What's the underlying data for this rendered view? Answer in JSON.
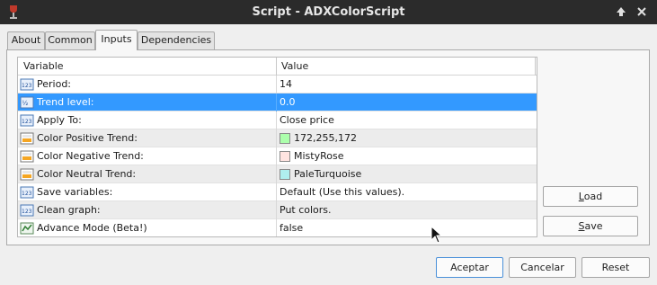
{
  "window": {
    "title": "Script - ADXColorScript"
  },
  "tabs": [
    {
      "label": "About"
    },
    {
      "label": "Common"
    },
    {
      "label": "Inputs"
    },
    {
      "label": "Dependencies"
    }
  ],
  "table": {
    "headers": {
      "variable": "Variable",
      "value": "Value"
    },
    "rows": [
      {
        "icon": "123-int-icon",
        "name": "Period:",
        "value": "14"
      },
      {
        "icon": "decimal-icon",
        "name": "Trend level:",
        "value": "0.0",
        "selected": true
      },
      {
        "icon": "123-int-icon",
        "name": "Apply To:",
        "value": "Close price"
      },
      {
        "icon": "color-icon",
        "name": "Color Positive Trend:",
        "value": "172,255,172",
        "swatch": "#acffac"
      },
      {
        "icon": "color-icon",
        "name": "Color Negative Trend:",
        "value": "MistyRose",
        "swatch": "#ffe4e1"
      },
      {
        "icon": "color-icon",
        "name": "Color Neutral Trend:",
        "value": "PaleTurquoise",
        "swatch": "#afeeee"
      },
      {
        "icon": "123-int-icon",
        "name": "Save variables:",
        "value": "Default (Use this values)."
      },
      {
        "icon": "123-int-icon",
        "name": "Clean graph:",
        "value": "Put colors."
      },
      {
        "icon": "bool-icon",
        "name": "Advance Mode (Beta!)",
        "value": "false"
      }
    ]
  },
  "side_buttons": {
    "load_u": "L",
    "load_rest": "oad",
    "save_u": "S",
    "save_rest": "ave"
  },
  "footer_buttons": {
    "ok": "Aceptar",
    "cancel": "Cancelar",
    "reset": "Reset"
  },
  "colors": {
    "selection": "#3399ff",
    "titlebar": "#2b2b2b"
  }
}
